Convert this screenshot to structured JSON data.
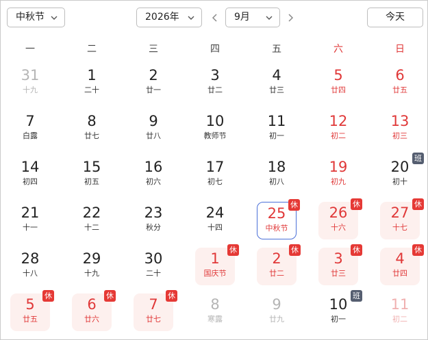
{
  "festival_dropdown": {
    "value": "中秋节"
  },
  "year_select": {
    "value": "2026年"
  },
  "month_select": {
    "value": "9月"
  },
  "today_button": {
    "label": "今天"
  },
  "weekdays": [
    "一",
    "二",
    "三",
    "四",
    "五",
    "六",
    "日"
  ],
  "colors": {
    "red": "#e03838",
    "holiday_bg": "#fdf0ee",
    "today_border": "#4a6fd8",
    "rest_tag": "#e53935",
    "work_tag": "#555e70"
  },
  "tags": {
    "rest": "休",
    "work": "班"
  },
  "weeks": [
    [
      {
        "day": "31",
        "sub": "十九",
        "other": true
      },
      {
        "day": "1",
        "sub": "二十"
      },
      {
        "day": "2",
        "sub": "廿一"
      },
      {
        "day": "3",
        "sub": "廿二"
      },
      {
        "day": "4",
        "sub": "廿三"
      },
      {
        "day": "5",
        "sub": "廿四",
        "red": true
      },
      {
        "day": "6",
        "sub": "廿五",
        "red": true
      }
    ],
    [
      {
        "day": "7",
        "sub": "白露"
      },
      {
        "day": "8",
        "sub": "廿七"
      },
      {
        "day": "9",
        "sub": "廿八"
      },
      {
        "day": "10",
        "sub": "教师节"
      },
      {
        "day": "11",
        "sub": "初一"
      },
      {
        "day": "12",
        "sub": "初二",
        "red": true
      },
      {
        "day": "13",
        "sub": "初三",
        "red": true
      }
    ],
    [
      {
        "day": "14",
        "sub": "初四"
      },
      {
        "day": "15",
        "sub": "初五"
      },
      {
        "day": "16",
        "sub": "初六"
      },
      {
        "day": "17",
        "sub": "初七"
      },
      {
        "day": "18",
        "sub": "初八"
      },
      {
        "day": "19",
        "sub": "初九",
        "red": true
      },
      {
        "day": "20",
        "sub": "初十",
        "tag": "work"
      }
    ],
    [
      {
        "day": "21",
        "sub": "十一"
      },
      {
        "day": "22",
        "sub": "十二"
      },
      {
        "day": "23",
        "sub": "秋分"
      },
      {
        "day": "24",
        "sub": "十四"
      },
      {
        "day": "25",
        "sub": "中秋节",
        "red": true,
        "today": true,
        "tag": "rest"
      },
      {
        "day": "26",
        "sub": "十六",
        "red": true,
        "holiday": true,
        "tag": "rest"
      },
      {
        "day": "27",
        "sub": "十七",
        "red": true,
        "holiday": true,
        "tag": "rest"
      }
    ],
    [
      {
        "day": "28",
        "sub": "十八"
      },
      {
        "day": "29",
        "sub": "十九"
      },
      {
        "day": "30",
        "sub": "二十"
      },
      {
        "day": "1",
        "sub": "国庆节",
        "red": true,
        "holiday": true,
        "tag": "rest"
      },
      {
        "day": "2",
        "sub": "廿二",
        "red": true,
        "holiday": true,
        "tag": "rest"
      },
      {
        "day": "3",
        "sub": "廿三",
        "red": true,
        "holiday": true,
        "tag": "rest"
      },
      {
        "day": "4",
        "sub": "廿四",
        "red": true,
        "holiday": true,
        "tag": "rest"
      }
    ],
    [
      {
        "day": "5",
        "sub": "廿五",
        "red": true,
        "holiday": true,
        "tag": "rest"
      },
      {
        "day": "6",
        "sub": "廿六",
        "red": true,
        "holiday": true,
        "tag": "rest"
      },
      {
        "day": "7",
        "sub": "廿七",
        "red": true,
        "holiday": true,
        "tag": "rest"
      },
      {
        "day": "8",
        "sub": "寒露",
        "other": true
      },
      {
        "day": "9",
        "sub": "廿九",
        "other": true
      },
      {
        "day": "10",
        "sub": "初一",
        "tag": "work"
      },
      {
        "day": "11",
        "sub": "初二",
        "other": true,
        "red": true
      }
    ]
  ]
}
